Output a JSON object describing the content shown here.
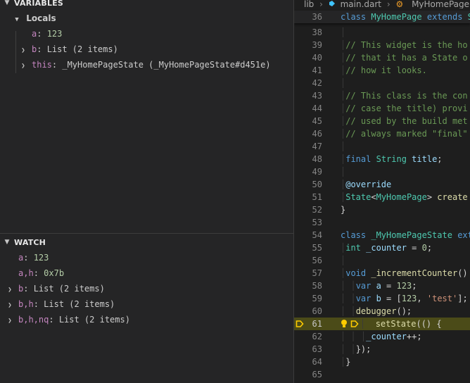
{
  "debug": {
    "variables_title": "VARIABLES",
    "locals_label": "Locals",
    "locals": [
      {
        "name": "a",
        "value": "123",
        "kind": "number",
        "expandable": false
      },
      {
        "name": "b",
        "value": "List (2 items)",
        "kind": "plain",
        "expandable": true
      },
      {
        "name": "this",
        "value": "_MyHomePageState (_MyHomePageState#d451e)",
        "kind": "plain",
        "expandable": true
      }
    ],
    "watch_title": "WATCH",
    "watch": [
      {
        "name": "a",
        "value": "123",
        "kind": "number",
        "expandable": false
      },
      {
        "name": "a,h",
        "value": "0x7b",
        "kind": "number",
        "expandable": false
      },
      {
        "name": "b",
        "value": "List (2 items)",
        "kind": "plain",
        "expandable": true
      },
      {
        "name": "b,h",
        "value": "List (2 items)",
        "kind": "plain",
        "expandable": true
      },
      {
        "name": "b,h,nq",
        "value": "List (2 items)",
        "kind": "plain",
        "expandable": true
      }
    ]
  },
  "editor": {
    "breadcrumb": [
      "lib",
      "main.dart",
      "_MyHomePage"
    ],
    "active_line": 61,
    "icons": {
      "current_line": "debug-stackframe-arrow-icon",
      "lightbulb": "lightbulb-icon"
    },
    "colors": {
      "current_line_bg": "#4b4b18",
      "arrow": "#ffcc00",
      "bulb": "#ffcc00"
    },
    "lines": [
      {
        "n": 36,
        "sticky": true,
        "tokens": [
          [
            "kw",
            "class "
          ],
          [
            "ty",
            "MyHomePage "
          ],
          [
            "kw",
            "extends "
          ],
          [
            "ty",
            "S"
          ]
        ]
      },
      {
        "n": 38,
        "tokens": [
          [
            "ws",
            "│"
          ]
        ]
      },
      {
        "n": 39,
        "tokens": [
          [
            "ws",
            "│"
          ],
          [
            "cm",
            "// This widget is the ho"
          ]
        ]
      },
      {
        "n": 40,
        "tokens": [
          [
            "ws",
            "│"
          ],
          [
            "cm",
            "// that it has a State o"
          ]
        ]
      },
      {
        "n": 41,
        "tokens": [
          [
            "ws",
            "│"
          ],
          [
            "cm",
            "// how it looks."
          ]
        ]
      },
      {
        "n": 42,
        "tokens": [
          [
            "ws",
            "│"
          ]
        ]
      },
      {
        "n": 43,
        "tokens": [
          [
            "ws",
            "│"
          ],
          [
            "cm",
            "// This class is the con"
          ]
        ]
      },
      {
        "n": 44,
        "tokens": [
          [
            "ws",
            "│"
          ],
          [
            "cm",
            "// case the title) provi"
          ]
        ]
      },
      {
        "n": 45,
        "tokens": [
          [
            "ws",
            "│"
          ],
          [
            "cm",
            "// used by the build met"
          ]
        ]
      },
      {
        "n": 46,
        "tokens": [
          [
            "ws",
            "│"
          ],
          [
            "cm",
            "// always marked \"final\""
          ]
        ]
      },
      {
        "n": 47,
        "tokens": [
          [
            "ws",
            "│"
          ]
        ]
      },
      {
        "n": 48,
        "tokens": [
          [
            "ws",
            "│"
          ],
          [
            "kw",
            "final "
          ],
          [
            "ty",
            "String "
          ],
          [
            "vr",
            "title"
          ],
          [
            "p",
            ";"
          ]
        ]
      },
      {
        "n": 49,
        "tokens": [
          [
            "ws",
            "│"
          ]
        ]
      },
      {
        "n": 50,
        "tokens": [
          [
            "ws",
            "│"
          ],
          [
            "vr",
            "@override"
          ]
        ]
      },
      {
        "n": 51,
        "tokens": [
          [
            "ws",
            "│"
          ],
          [
            "ty",
            "State"
          ],
          [
            "p",
            "<"
          ],
          [
            "ty",
            "MyHomePage"
          ],
          [
            "p",
            "> "
          ],
          [
            "fn",
            "create"
          ]
        ]
      },
      {
        "n": 52,
        "tokens": [
          [
            "p",
            "}"
          ]
        ]
      },
      {
        "n": 53,
        "tokens": []
      },
      {
        "n": 54,
        "tokens": [
          [
            "kw",
            "class "
          ],
          [
            "ty",
            "_MyHomePageState "
          ],
          [
            "kw",
            "ext"
          ]
        ]
      },
      {
        "n": 55,
        "tokens": [
          [
            "ws",
            "│"
          ],
          [
            "ty",
            "int "
          ],
          [
            "vr",
            "_counter "
          ],
          [
            "p",
            "= "
          ],
          [
            "nm",
            "0"
          ],
          [
            "p",
            ";"
          ]
        ]
      },
      {
        "n": 56,
        "tokens": [
          [
            "ws",
            "│"
          ]
        ]
      },
      {
        "n": 57,
        "tokens": [
          [
            "ws",
            "│"
          ],
          [
            "kw",
            "void "
          ],
          [
            "fn",
            "_incrementCounter"
          ],
          [
            "p",
            "()"
          ]
        ]
      },
      {
        "n": 58,
        "tokens": [
          [
            "ws",
            "│ │"
          ],
          [
            "kw",
            "var "
          ],
          [
            "vr",
            "a "
          ],
          [
            "p",
            "= "
          ],
          [
            "nm",
            "123"
          ],
          [
            "p",
            ";"
          ]
        ]
      },
      {
        "n": 59,
        "tokens": [
          [
            "ws",
            "│ │"
          ],
          [
            "kw",
            "var "
          ],
          [
            "vr",
            "b "
          ],
          [
            "p",
            "= ["
          ],
          [
            "nm",
            "123"
          ],
          [
            "p",
            ", "
          ],
          [
            "str",
            "'test'"
          ],
          [
            "p",
            "];"
          ]
        ]
      },
      {
        "n": 60,
        "tokens": [
          [
            "ws",
            "│ │"
          ],
          [
            "fn",
            "debugger"
          ],
          [
            "p",
            "();"
          ]
        ]
      },
      {
        "n": 61,
        "tokens": [
          [
            "ws",
            "│  "
          ],
          [
            "fn",
            "setState"
          ],
          [
            "p",
            "(() {"
          ]
        ]
      },
      {
        "n": 62,
        "tokens": [
          [
            "ws",
            "│ │ │"
          ],
          [
            "vr",
            "_counter"
          ],
          [
            "p",
            "++;"
          ]
        ]
      },
      {
        "n": 63,
        "tokens": [
          [
            "ws",
            "│ │"
          ],
          [
            "p",
            "});"
          ]
        ]
      },
      {
        "n": 64,
        "tokens": [
          [
            "ws",
            "│"
          ],
          [
            "p",
            "}"
          ]
        ]
      },
      {
        "n": 65,
        "tokens": []
      }
    ]
  }
}
